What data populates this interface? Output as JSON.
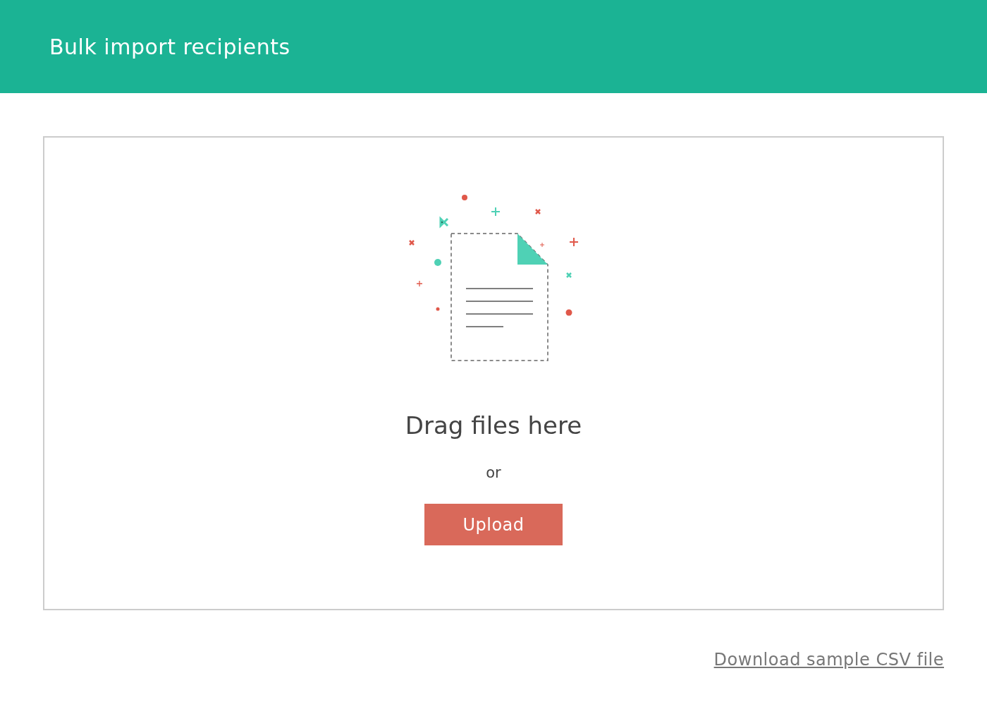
{
  "header": {
    "title": "Bulk import recipients"
  },
  "dropzone": {
    "heading": "Drag files here",
    "separator": "or",
    "button": "Upload"
  },
  "footer_link": "Download sample CSV file"
}
